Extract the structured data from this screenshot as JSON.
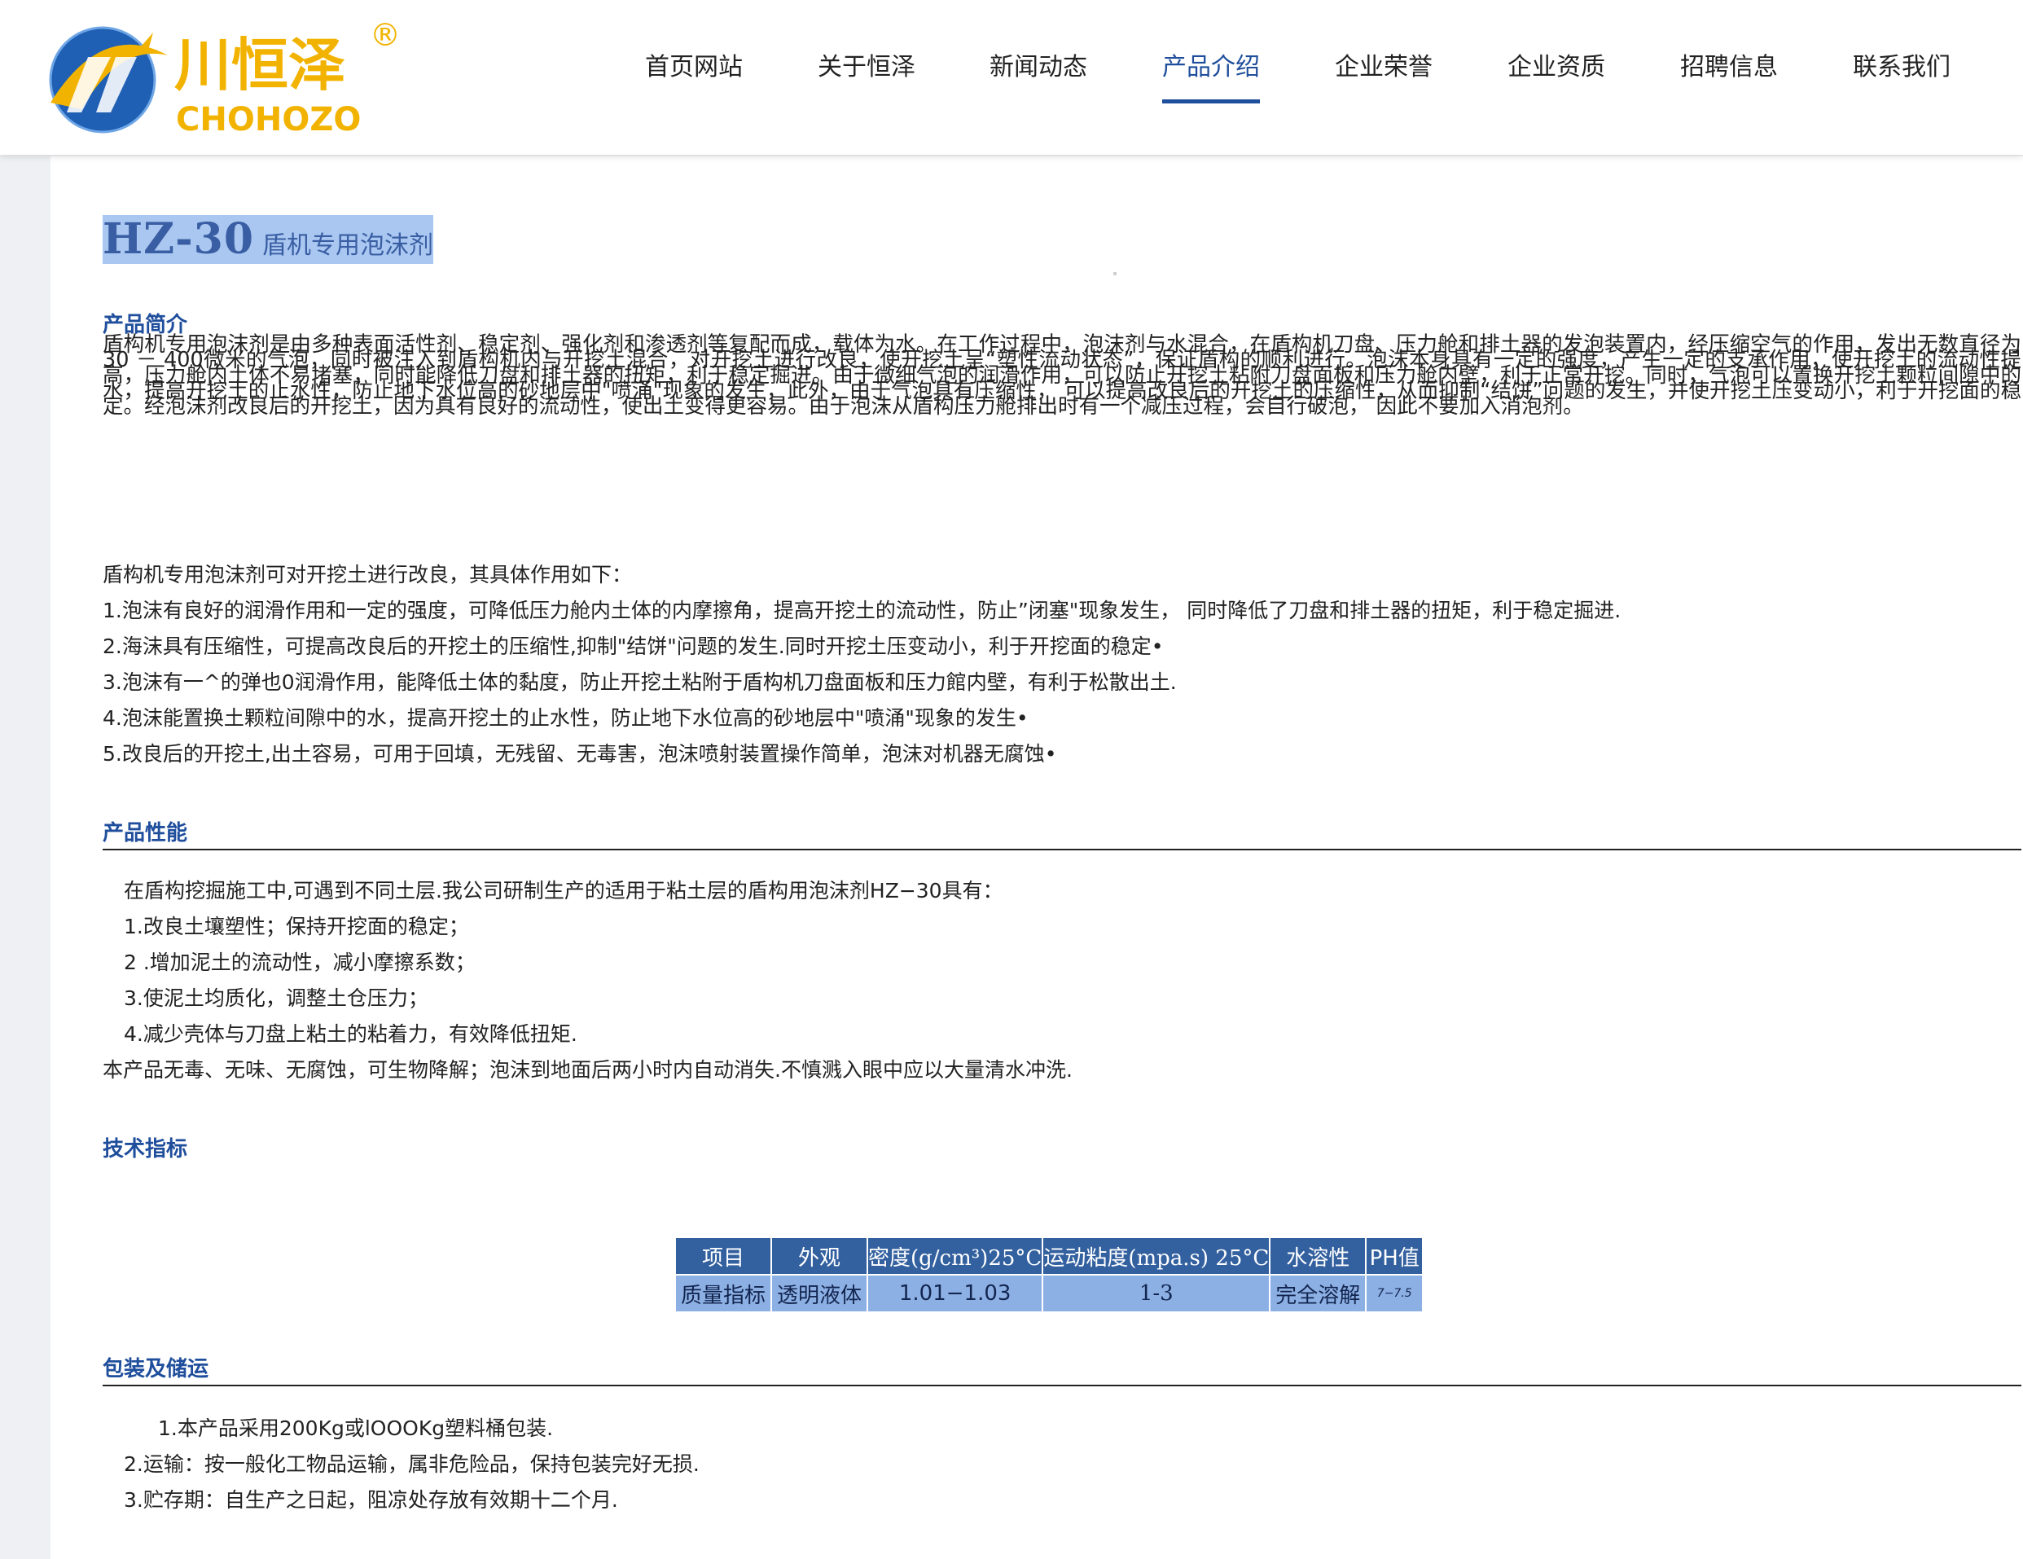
{
  "brand": {
    "name_cn": "川恒泽",
    "name_en": "CHOHOZO",
    "registered": "®",
    "colors": {
      "accent": "#1f4e9c",
      "logo_blue": "#1f5fb4",
      "logo_gold": "#f2b300"
    }
  },
  "nav": {
    "items": [
      {
        "label": "首页网站"
      },
      {
        "label": "关于恒泽"
      },
      {
        "label": "新闻动态"
      },
      {
        "label": "产品介绍"
      },
      {
        "label": "企业荣誉"
      },
      {
        "label": "企业资质"
      },
      {
        "label": "招聘信息"
      },
      {
        "label": "联系我们"
      }
    ],
    "active_index": 3
  },
  "product": {
    "code": "HZ-30",
    "name": "盾机专用泡沫剂"
  },
  "intro": {
    "title": "产品简介",
    "text": "盾构机专用泡沫剂是由多种表面活性剂、稳定剂、强化剂和渗透剂等复配而成，载体为水。在工作过程中，泡沫剂与水混合，在盾构机刀盘、压力舱和排土器的发泡装置内，经压缩空气的作用，发出无数直径为30 － 400微米的气泡，同时被注入到盾构机内与开挖土混合，对开挖土进行改良，使开挖土呈“塑性流动状态”，保证盾构的顺利进行。泡沫本身具有一定的强度，产生一定的支承作用，使开挖土的流动性提高，压力舱内土体不易堵塞，同时能降低刀盘和排土器的扭矩，利于稳定掘进。由于微细气泡的润滑作用，可以防止开挖土粘附刀盘面板和压力舱内壁，利于正常开挖。同时，气泡可以置换开挖土颗粒间隙中的水，提高开挖土的止水性，防止地下水位高的砂地层中\"喷涌\"现象的发生，此外，由于气泡具有压缩性， 可以提高改良后的开挖土的压缩性，从而抑制“结饼”问题的发生，并使开挖土压变动小，利于开挖面的稳定。经泡沫剂改良后的开挖土，因为具有良好的流动性，使出土变得更容易。由于泡沫从盾构压力舱排出时有一个减压过程，会自行破泡， 因此不要加入消泡剂。",
    "list_intro": "盾构机专用泡沫剂可对开挖土进行改良，其具体作用如下：",
    "list": [
      "1.泡沫有良好的润滑作用和一定的强度，可降低压力舱内土体的内摩擦角，提高开挖土的流动性，防止”闭塞\"现象发生， 同时降低了刀盘和排土器的扭矩，利于稳定掘进.",
      "2.海沫具有压缩性，可提高改良后的开挖土的压缩性,抑制\"结饼\"问题的发生.同时开挖土压变动小，利于开挖面的稳定•",
      "3.泡沫有一^的弹也0润滑作用，能降低土体的黏度，防止开挖土粘附于盾构机刀盘面板和压力館内壁，有利于松散出土.",
      "4.泡沫能置换土颗粒间隙中的水，提高开挖土的止水性，防止地下水位高的砂地层中\"喷涌\"现象的发生•",
      "5.改良后的开挖土,出土容易，可用于回填，无残留、无毒害，泡沫喷射装置操作简单，泡沫对机器无腐蚀•"
    ]
  },
  "performance": {
    "title": "产品性能",
    "intro": "在盾构挖掘施工中,可遇到不同土层.我公司研制生产的适用于粘土层的盾构用泡沫剂HZ−30具有：",
    "list": [
      "1.改良土壤塑性；保持开挖面的稳定；",
      "2 .增加泥土的流动性，减小摩擦系数；",
      "3.使泥土均质化，调整土仓压力；",
      "4.减少壳体与刀盘上粘土的粘着力，有效降低扭矩."
    ],
    "note": "本产品无毒、无味、无腐蚀，可生物降解；泡沫到地面后两小时内自动消失.不慎溅入眼中应以大量清水冲洗."
  },
  "spec": {
    "title": "技术指标",
    "headers": [
      "项目",
      "外观",
      "密度(g/cm³)25°C",
      "运动粘度(mpa.s) 25°C",
      "水溶性",
      "PH值"
    ],
    "row": [
      "质量指标",
      "透明液体",
      "1.01−1.03",
      "1-3",
      "完全溶解",
      "7−7.5"
    ]
  },
  "packaging": {
    "title": "包装及储运",
    "lines": [
      "1.本产品采用200Kg或lOOOKg塑料桶包装.",
      "2.运输：按一般化工物品运输，属非危险品，保持包装完好无损.",
      "3.贮存期：自生产之日起，阻凉处存放有效期十二个月."
    ]
  }
}
